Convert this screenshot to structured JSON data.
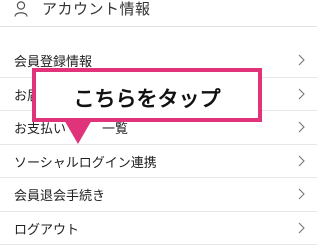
{
  "header": {
    "title": "アカウント情報",
    "icon": "person-icon"
  },
  "menu": {
    "items": [
      {
        "label": "会員登録情報",
        "icon": "chevron-right-icon"
      },
      {
        "label": "お届",
        "icon": "chevron-right-icon"
      },
      {
        "label": "お支払い",
        "label_suffix": "一覧",
        "icon": "chevron-right-icon"
      },
      {
        "label": "ソーシャルログイン連携",
        "icon": "chevron-right-icon"
      },
      {
        "label": "会員退会手続き",
        "icon": "chevron-right-icon"
      },
      {
        "label": "ログアウト",
        "icon": "chevron-right-icon"
      }
    ]
  },
  "callout": {
    "text": "こちらをタップ",
    "color": "#e0337a"
  }
}
